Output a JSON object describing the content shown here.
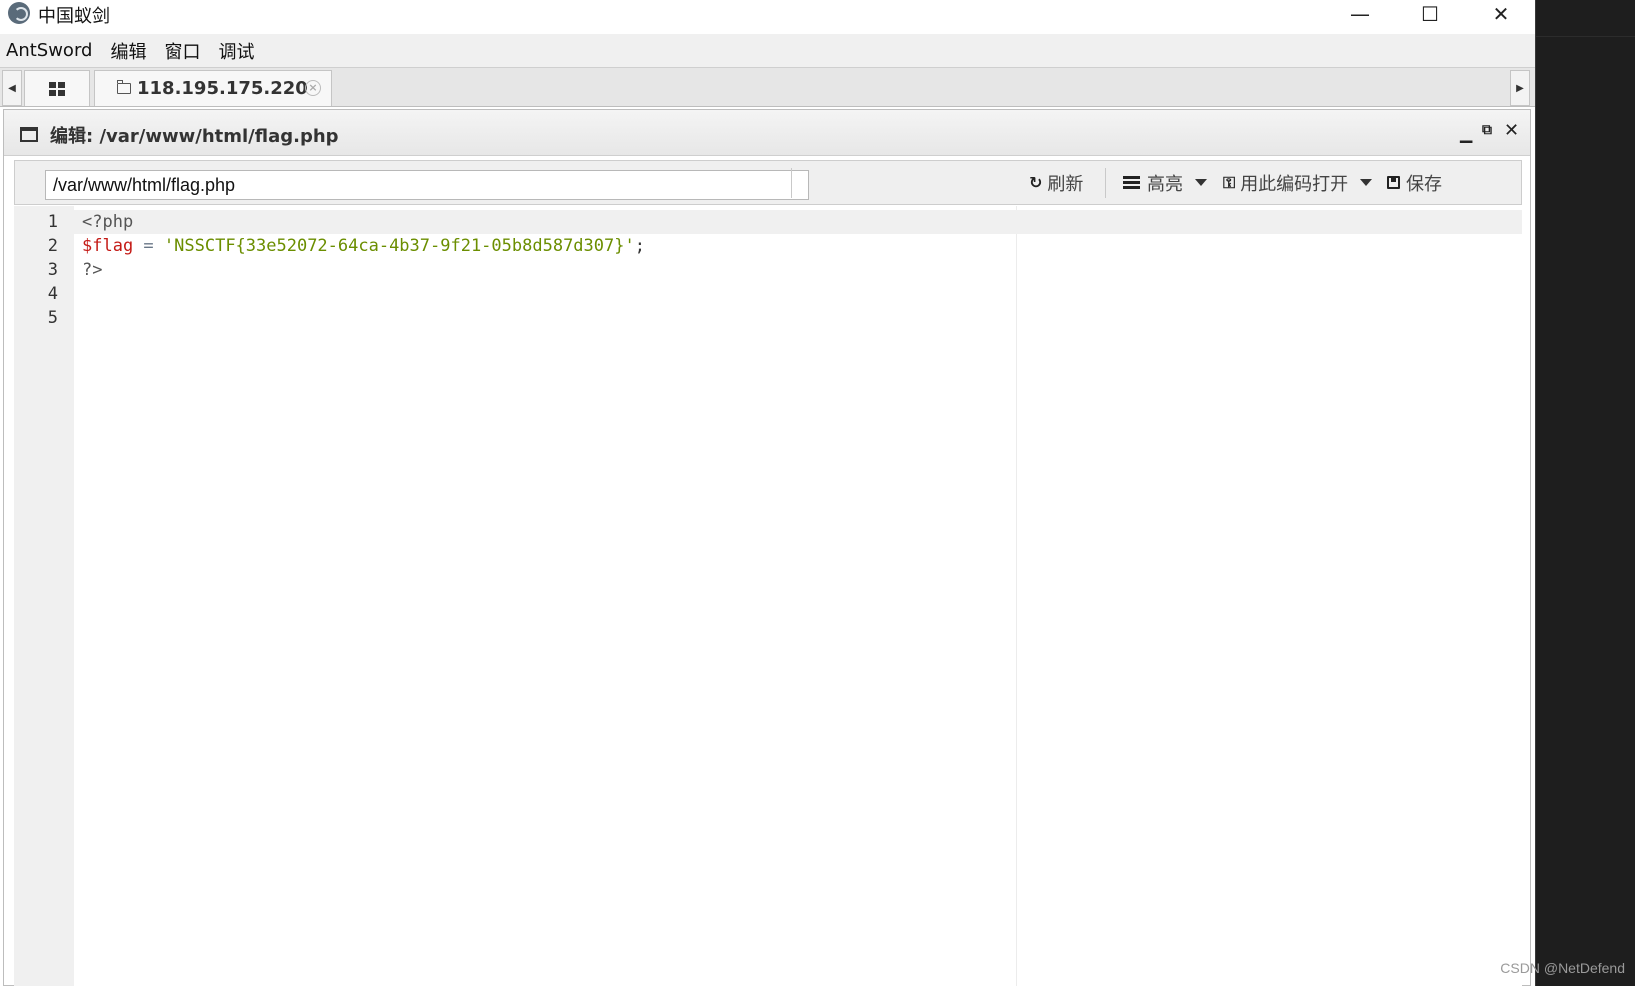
{
  "window": {
    "title": "中国蚁剑",
    "minimize_glyph": "—",
    "maximize_glyph": "☐",
    "close_glyph": "✕"
  },
  "menu": [
    "AntSword",
    "编辑",
    "窗口",
    "调试"
  ],
  "tabs": {
    "host_label": "118.195.175.220",
    "close_glyph": "×"
  },
  "panel": {
    "title": "编辑: /var/www/html/flag.php"
  },
  "toolbar": {
    "path_value": "/var/www/html/flag.php",
    "refresh_label": "刷新",
    "highlight_label": "高亮",
    "encoding_label": "用此编码打开",
    "save_label": "保存"
  },
  "code_lines": [
    {
      "num": "1",
      "tag_open": "<?php"
    },
    {
      "num": "2",
      "var": "$flag",
      "op": " = ",
      "str": "'NSSCTF{33e52072-64ca-4b37-9f21-05b8d587d307}'",
      "punc": ";"
    },
    {
      "num": "3",
      "tag_close": "?>"
    },
    {
      "num": "4"
    },
    {
      "num": "5"
    }
  ],
  "watermark": "CSDN @NetDefend",
  "colors": {
    "variable": "#c41a16",
    "string": "#6b8e00",
    "dark_strip": "#1e1e1e"
  }
}
